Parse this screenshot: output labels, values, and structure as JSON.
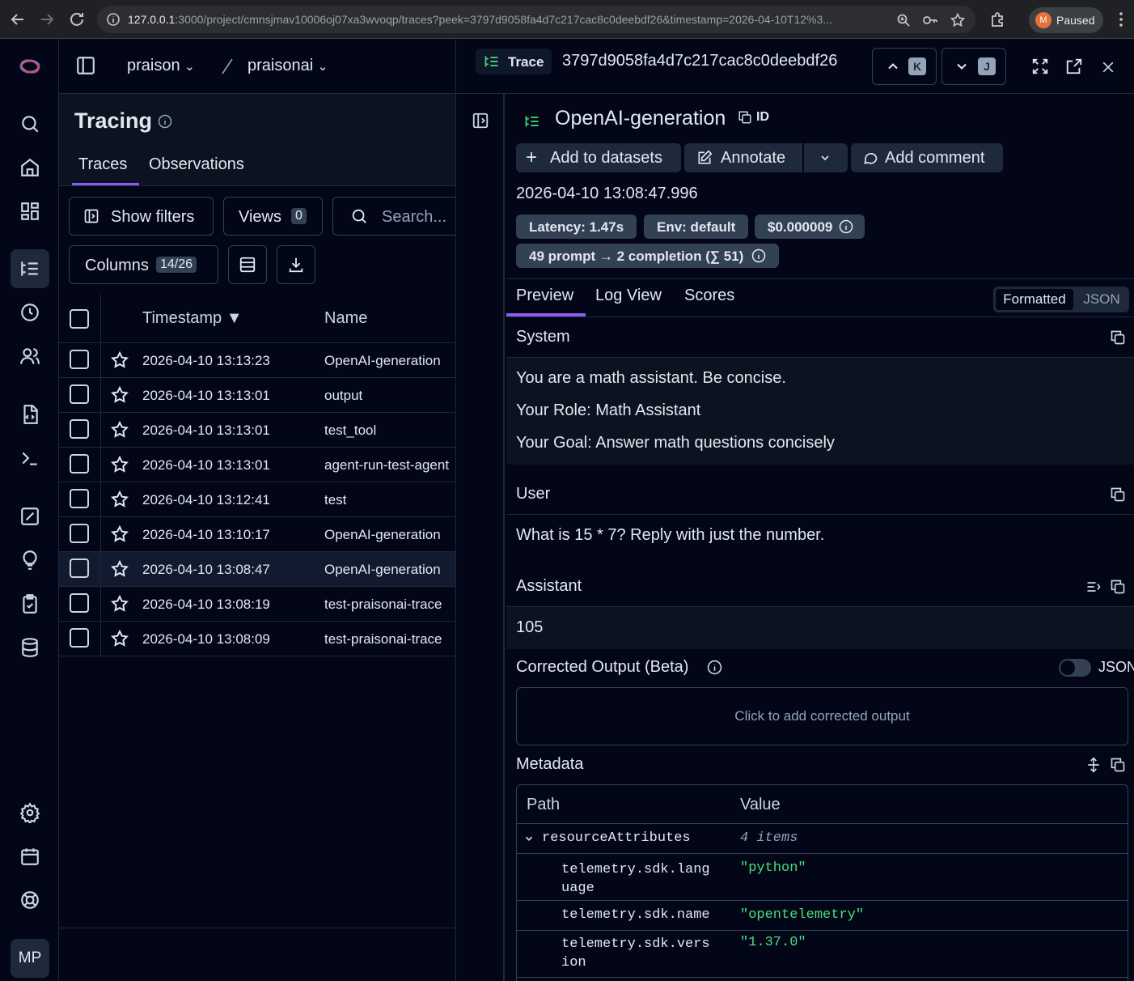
{
  "browser": {
    "url_host": "127.0.0.1",
    "url_rest": ":3000/project/cmnsjmav10006oj07xa3wvoqp/traces?peek=3797d9058fa4d7c217cac8c0deebdf26&timestamp=2026-04-10T12%3...",
    "profile_initial": "M",
    "profile_status": "Paused"
  },
  "nav": {
    "user_initials": "MP"
  },
  "breadcrumb": {
    "org": "praison",
    "project": "praisonai"
  },
  "tracing": {
    "title": "Tracing",
    "tabs": [
      "Traces",
      "Observations"
    ],
    "show_filters": "Show filters",
    "views": "Views",
    "views_count": "0",
    "search_placeholder": "Search...",
    "columns": "Columns",
    "columns_count": "14/26"
  },
  "table": {
    "headers": [
      "Timestamp ▼",
      "Name"
    ],
    "rows": [
      {
        "timestamp": "2026-04-10 13:13:23",
        "name": "OpenAI-generation"
      },
      {
        "timestamp": "2026-04-10 13:13:01",
        "name": "output"
      },
      {
        "timestamp": "2026-04-10 13:13:01",
        "name": "test_tool"
      },
      {
        "timestamp": "2026-04-10 13:13:01",
        "name": "agent-run-test-agent"
      },
      {
        "timestamp": "2026-04-10 13:12:41",
        "name": "test"
      },
      {
        "timestamp": "2026-04-10 13:10:17",
        "name": "OpenAI-generation"
      },
      {
        "timestamp": "2026-04-10 13:08:47",
        "name": "OpenAI-generation"
      },
      {
        "timestamp": "2026-04-10 13:08:19",
        "name": "test-praisonai-trace"
      },
      {
        "timestamp": "2026-04-10 13:08:09",
        "name": "test-praisonai-trace"
      }
    ]
  },
  "trace": {
    "badge": "Trace",
    "id": "3797d9058fa4d7c217cac8c0deebdf26",
    "prev_key": "K",
    "next_key": "J"
  },
  "observation": {
    "title": "OpenAI-generation",
    "id_label": "ID",
    "add_to_datasets": "Add to datasets",
    "annotate": "Annotate",
    "add_comment": "Add comment",
    "timestamp": "2026-04-10 13:08:47.996",
    "latency": "Latency: 1.47s",
    "env": "Env: default",
    "cost": "$0.000009",
    "tokens": "49 prompt → 2 completion (∑ 51)",
    "tabs": [
      "Preview",
      "Log View",
      "Scores"
    ],
    "format_options": [
      "Formatted",
      "JSON"
    ]
  },
  "messages": {
    "system_label": "System",
    "system_lines": [
      "You are a math assistant. Be concise.",
      "Your Role: Math Assistant",
      "Your Goal: Answer math questions concisely"
    ],
    "user_label": "User",
    "user_text": "What is 15 * 7? Reply with just the number.",
    "assistant_label": "Assistant",
    "assistant_text": "105"
  },
  "corrected": {
    "title": "Corrected Output (Beta)",
    "json_label": "JSON",
    "placeholder": "Click to add corrected output"
  },
  "metadata": {
    "title": "Metadata",
    "headers": [
      "Path",
      "Value"
    ],
    "group": {
      "path": "resourceAttributes",
      "value": "4 items"
    },
    "rows": [
      {
        "path_line1": "telemetry.sdk.lang",
        "path_line2": "uage",
        "value": "\"python\""
      },
      {
        "path_line1": "telemetry.sdk.name",
        "path_line2": "",
        "value": "\"opentelemetry\""
      },
      {
        "path_line1": "telemetry.sdk.vers",
        "path_line2": "ion",
        "value": "\"1.37.0\""
      }
    ]
  },
  "colors": {
    "background": "#020617",
    "panel": "#0b1220",
    "accent": "#8b5cf6",
    "json_green": "#4ade80"
  }
}
